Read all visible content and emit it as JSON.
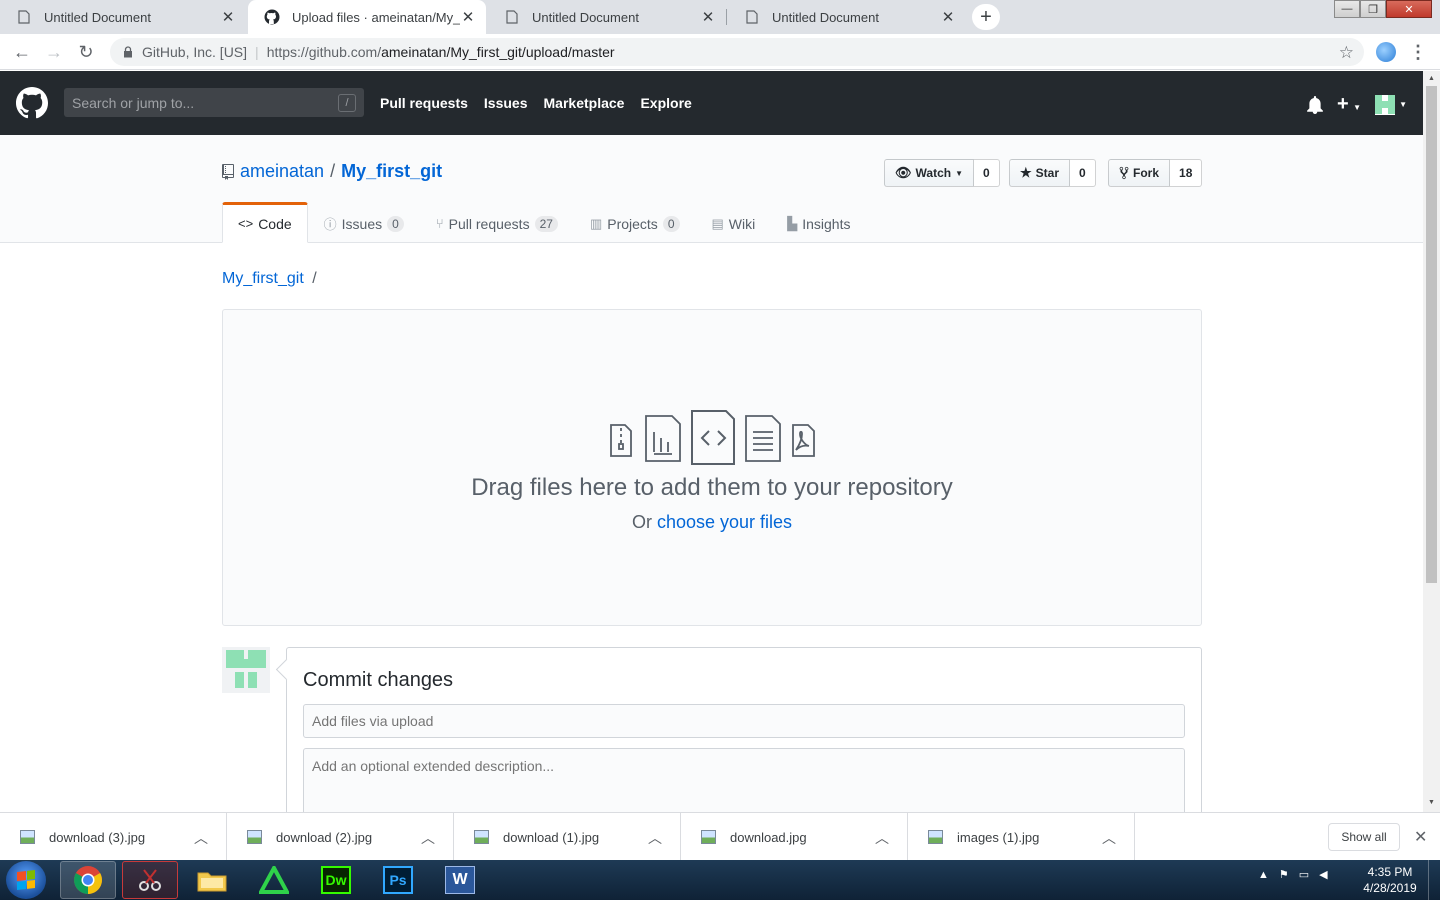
{
  "browser": {
    "tabs": [
      {
        "title": "Untitled Document",
        "favicon": "document-icon",
        "active": false
      },
      {
        "title": "Upload files · ameinatan/My_first",
        "favicon": "github-icon",
        "active": true
      },
      {
        "title": "Untitled Document",
        "favicon": "document-icon",
        "active": false
      },
      {
        "title": "Untitled Document",
        "favicon": "document-icon",
        "active": false
      }
    ],
    "site_identity": "GitHub, Inc. [US]",
    "url_prefix": "https://github.com/",
    "url_path": "ameinatan/My_first_git/upload/master"
  },
  "github": {
    "search_placeholder": "Search or jump to...",
    "search_shortcut": "/",
    "nav": [
      "Pull requests",
      "Issues",
      "Marketplace",
      "Explore"
    ]
  },
  "repo": {
    "owner": "ameinatan",
    "separator": "/",
    "name": "My_first_git",
    "actions": {
      "watch_label": "Watch",
      "watch_count": "0",
      "star_label": "Star",
      "star_count": "0",
      "fork_label": "Fork",
      "fork_count": "18"
    },
    "tabs": [
      {
        "label": "Code",
        "icon": "code-icon",
        "count": null,
        "selected": true
      },
      {
        "label": "Issues",
        "icon": "issue-icon",
        "count": "0",
        "selected": false
      },
      {
        "label": "Pull requests",
        "icon": "pull-request-icon",
        "count": "27",
        "selected": false
      },
      {
        "label": "Projects",
        "icon": "project-icon",
        "count": "0",
        "selected": false
      },
      {
        "label": "Wiki",
        "icon": "book-icon",
        "count": null,
        "selected": false
      },
      {
        "label": "Insights",
        "icon": "graph-icon",
        "count": null,
        "selected": false
      }
    ]
  },
  "upload": {
    "breadcrumb_repo": "My_first_git",
    "breadcrumb_sep": "/",
    "drop_title": "Drag files here to add them to your repository",
    "drop_or": "Or",
    "choose_link": "choose your files"
  },
  "commit": {
    "title": "Commit changes",
    "summary_placeholder": "Add files via upload",
    "description_placeholder": "Add an optional extended description..."
  },
  "downloads": {
    "items": [
      "download (3).jpg",
      "download (2).jpg",
      "download (1).jpg",
      "download.jpg",
      "images (1).jpg"
    ],
    "show_all": "Show all"
  },
  "taskbar": {
    "time": "4:35 PM",
    "date": "4/28/2019",
    "apps": [
      "chrome-icon",
      "snipping-tool-icon",
      "file-explorer-icon",
      "autocad-icon",
      "dreamweaver-icon",
      "photoshop-icon",
      "word-icon"
    ],
    "dw_label": "Dw",
    "ps_label": "Ps",
    "word_label": "W"
  },
  "colors": {
    "github_header": "#24292e",
    "link_blue": "#0366d6",
    "tab_accent": "#e36209",
    "taskbar": "#1e3a55"
  }
}
